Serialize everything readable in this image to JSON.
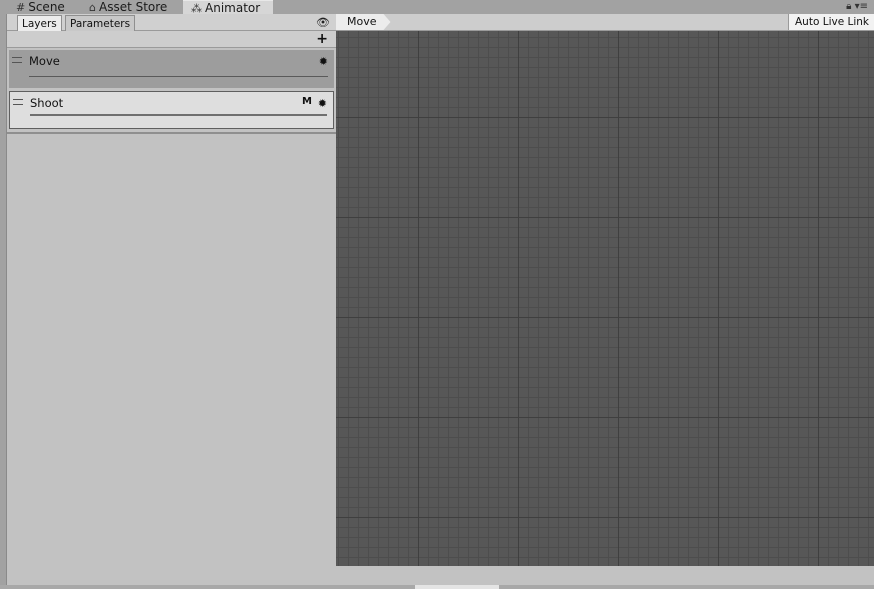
{
  "editor_tabs": [
    {
      "label": "Scene",
      "icon": "grid-icon"
    },
    {
      "label": "Asset Store",
      "icon": "store-icon"
    },
    {
      "label": "Animator",
      "icon": "animator-icon"
    }
  ],
  "active_tab": "Animator",
  "left_panel": {
    "tabs": [
      {
        "label": "Layers",
        "selected": true
      },
      {
        "label": "Parameters",
        "selected": false
      }
    ],
    "eye_icon": "eye-icon",
    "add_label": "+",
    "layers": [
      {
        "name": "Move",
        "mask_flag": "",
        "selected": true
      },
      {
        "name": "Shoot",
        "mask_flag": "M",
        "selected": false
      }
    ]
  },
  "graph": {
    "breadcrumb": "Move",
    "auto_live_link": "Auto Live Link"
  },
  "colors": {
    "panel": "#c2c2c2",
    "graph_bg": "#575757",
    "selected_layer": "#9d9d9d"
  }
}
